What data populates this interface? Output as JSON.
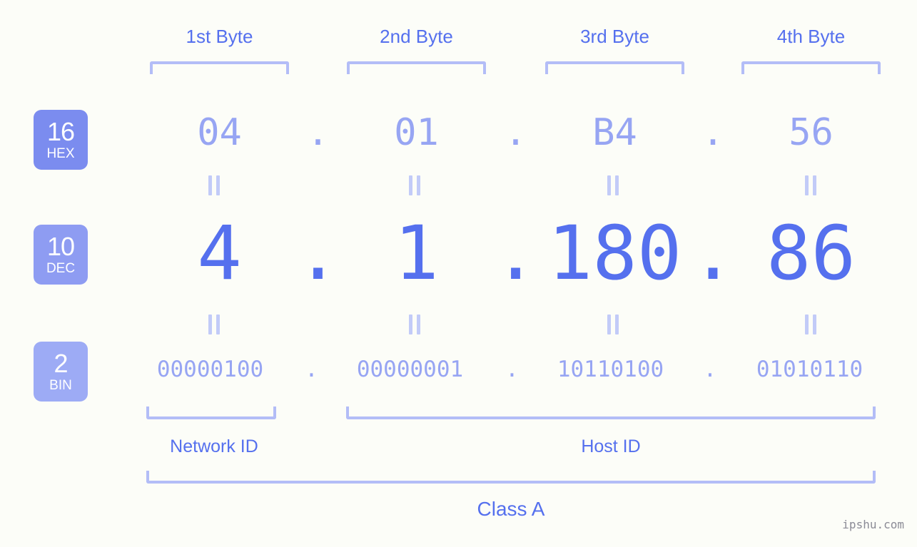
{
  "colors": {
    "background": "#fcfdf8",
    "accent_strong": "#5570ee",
    "accent_mid": "#97a5f3",
    "accent_light": "#b3bdf7",
    "badge_hex": "#7b8cef",
    "badge_dec": "#8e9cf2",
    "badge_bin": "#9dabf5",
    "watermark": "#8b8b96"
  },
  "byte_headers": [
    {
      "label": "1st Byte"
    },
    {
      "label": "2nd Byte"
    },
    {
      "label": "3rd Byte"
    },
    {
      "label": "4th Byte"
    }
  ],
  "rows": [
    {
      "badge_num": "16",
      "badge_name": "HEX",
      "values": [
        "04",
        "01",
        "B4",
        "56"
      ],
      "separator": "."
    },
    {
      "badge_num": "10",
      "badge_name": "DEC",
      "values": [
        "4",
        "1",
        "180",
        "86"
      ],
      "separator": "."
    },
    {
      "badge_num": "2",
      "badge_name": "BIN",
      "values": [
        "00000100",
        "00000001",
        "10110100",
        "01010110"
      ],
      "separator": "."
    }
  ],
  "sections": [
    {
      "label": "Network ID"
    },
    {
      "label": "Host ID"
    }
  ],
  "class_label": "Class A",
  "watermark": "ipshu.com"
}
